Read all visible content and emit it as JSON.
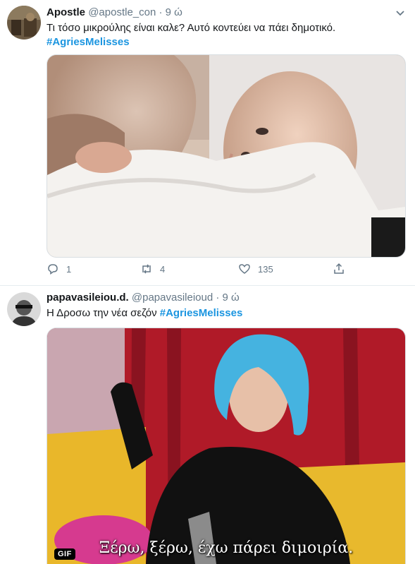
{
  "tweets": [
    {
      "display_name": "Apostle",
      "handle": "@apostle_con",
      "separator": "·",
      "time": "9 ώ",
      "text": "Τι τόσο μικρούλης είναι καλε? Αυτό κοντεύει να πάει δημοτικό.",
      "hashtag": "#AgriesMelisses",
      "actions": {
        "replies": "1",
        "retweets": "4",
        "likes": "135"
      }
    },
    {
      "display_name": "papavasileiou.d.",
      "handle": "@papavasileioud",
      "separator": "·",
      "time": "9 ώ",
      "text": "Η Δροσω την νέα σεζόν",
      "hashtag": "#AgriesMelisses",
      "media_badge": "GIF",
      "subtitle": "Ξέρω, ξέρω, έχω πάρει διμοιρία."
    }
  ],
  "icons": [
    "chevron-down-icon",
    "reply-icon",
    "retweet-icon",
    "like-icon",
    "share-icon"
  ],
  "colors": {
    "hashtag": "#1b95e0",
    "muted": "#657786",
    "divider": "#e6ecf0"
  }
}
